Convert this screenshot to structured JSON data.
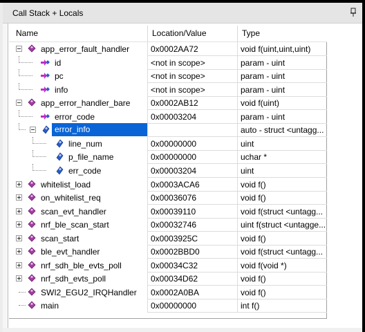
{
  "window": {
    "title": "Call Stack + Locals"
  },
  "columns": {
    "name": "Name",
    "location": "Location/Value",
    "type": "Type"
  },
  "rows": [
    {
      "name": "app_error_fault_handler",
      "location": "0x0002AA72",
      "type": "void f(uint,uint,uint)",
      "kind": "function",
      "expander": "minus"
    },
    {
      "name": "id",
      "location": "<not in scope>",
      "type": "param - uint",
      "kind": "param"
    },
    {
      "name": "pc",
      "location": "<not in scope>",
      "type": "param - uint",
      "kind": "param"
    },
    {
      "name": "info",
      "location": "<not in scope>",
      "type": "param - uint",
      "kind": "param"
    },
    {
      "name": "app_error_handler_bare",
      "location": "0x0002AB12",
      "type": "void f(uint)",
      "kind": "function",
      "expander": "minus"
    },
    {
      "name": "error_code",
      "location": "0x00003204",
      "type": "param - uint",
      "kind": "param"
    },
    {
      "name": "error_info",
      "location": "",
      "type": "auto - struct <untagg...",
      "kind": "local",
      "expander": "minus",
      "selected": true
    },
    {
      "name": "line_num",
      "location": "0x00000000",
      "type": "uint",
      "kind": "member"
    },
    {
      "name": "p_file_name",
      "location": "0x00000000",
      "type": "uchar *",
      "kind": "member"
    },
    {
      "name": "err_code",
      "location": "0x00003204",
      "type": "uint",
      "kind": "member"
    },
    {
      "name": "whitelist_load",
      "location": "0x0003ACA6",
      "type": "void f()",
      "kind": "function",
      "expander": "plus"
    },
    {
      "name": "on_whitelist_req",
      "location": "0x00036076",
      "type": "void f()",
      "kind": "function",
      "expander": "plus"
    },
    {
      "name": "scan_evt_handler",
      "location": "0x00039110",
      "type": "void f(struct <untagg...",
      "kind": "function",
      "expander": "plus"
    },
    {
      "name": "nrf_ble_scan_start",
      "location": "0x00032746",
      "type": "uint f(struct <untagge...",
      "kind": "function",
      "expander": "plus"
    },
    {
      "name": "scan_start",
      "location": "0x0003925C",
      "type": "void f()",
      "kind": "function",
      "expander": "plus"
    },
    {
      "name": "ble_evt_handler",
      "location": "0x0002BBD0",
      "type": "void f(struct <untagg...",
      "kind": "function",
      "expander": "plus"
    },
    {
      "name": "nrf_sdh_ble_evts_poll",
      "location": "0x00034C32",
      "type": "void f(void *)",
      "kind": "function",
      "expander": "plus"
    },
    {
      "name": "nrf_sdh_evts_poll",
      "location": "0x00034D62",
      "type": "void f()",
      "kind": "function",
      "expander": "plus"
    },
    {
      "name": "SWI2_EGU2_IRQHandler",
      "location": "0x0002A0BA",
      "type": "void f()",
      "kind": "function"
    },
    {
      "name": "main",
      "location": "0x00000000",
      "type": "int f()",
      "kind": "function"
    }
  ],
  "colors": {
    "function_icon": "#a23ea3",
    "param_arrow": "#c02cc6",
    "local_icon": "#2a5bc7",
    "selection": "#0a64d6"
  },
  "icons": {
    "function": "pink-diamond-icon",
    "param": "param-arrow-icon",
    "local": "blue-diamond-icon",
    "member": "blue-diamond-icon",
    "pin": "pin-icon"
  }
}
